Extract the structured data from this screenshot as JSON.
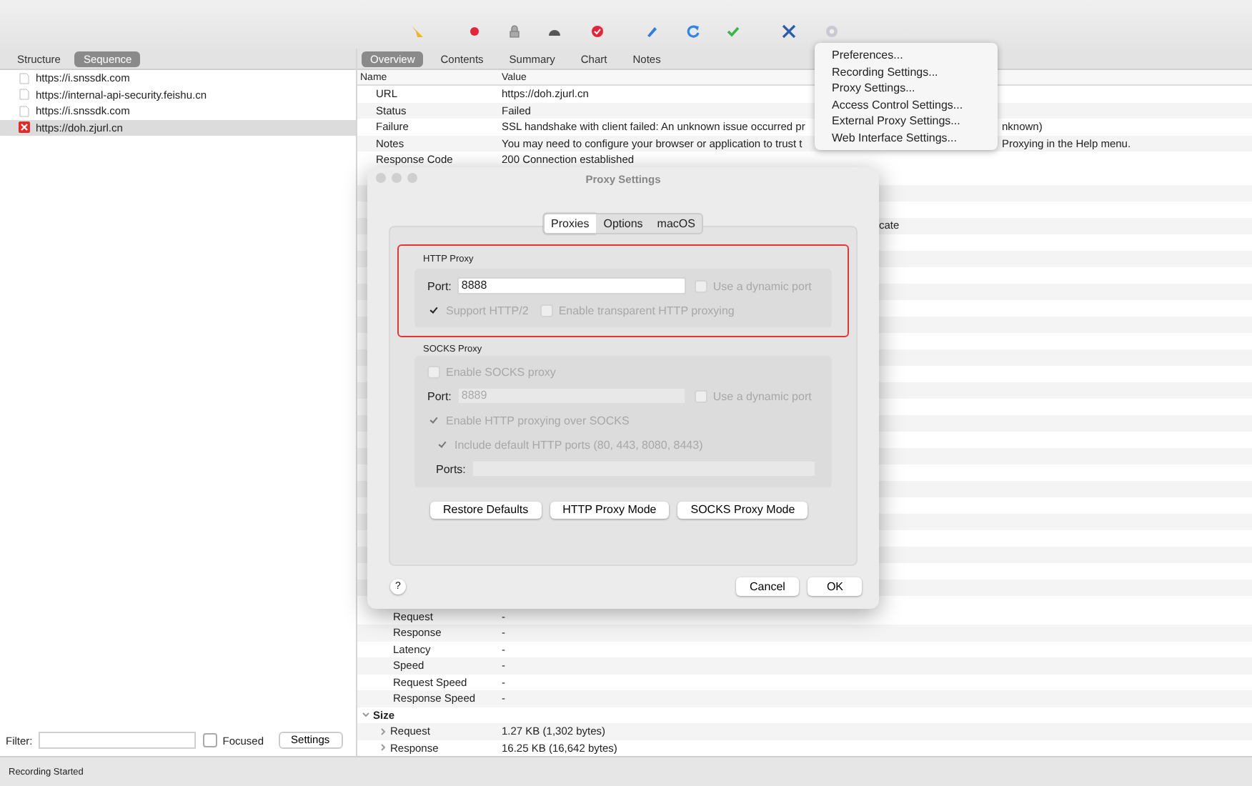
{
  "left_tabs": [
    {
      "label": "Structure",
      "selected": false
    },
    {
      "label": "Sequence",
      "selected": true
    }
  ],
  "hosts": [
    {
      "url": "https://i.snssdk.com",
      "failed": false,
      "selected": false
    },
    {
      "url": "https://internal-api-security.feishu.cn",
      "failed": false,
      "selected": false
    },
    {
      "url": "https://i.snssdk.com",
      "failed": false,
      "selected": false
    },
    {
      "url": "https://doh.zjurl.cn",
      "failed": true,
      "selected": true
    }
  ],
  "filter": {
    "label": "Filter:",
    "focused": {
      "label": "Focused",
      "checked": false
    },
    "settings_button": "Settings"
  },
  "right_tabs": [
    {
      "label": "Overview",
      "selected": true
    },
    {
      "label": "Contents",
      "selected": false
    },
    {
      "label": "Summary",
      "selected": false
    },
    {
      "label": "Chart",
      "selected": false
    },
    {
      "label": "Notes",
      "selected": false
    }
  ],
  "overview": {
    "columns": [
      "Name",
      "Value"
    ],
    "rows_top": [
      {
        "name": "URL",
        "value": "https://doh.zjurl.cn"
      },
      {
        "name": "Status",
        "value": "Failed"
      },
      {
        "name": "Failure",
        "value": "SSL handshake with client failed: An unknown issue occurred pr",
        "value_tail": "nknown)"
      },
      {
        "name": "Notes",
        "value": "You may need to configure your browser or application to trust t",
        "value_tail": "Proxying in the Help menu."
      },
      {
        "name": "Response Code",
        "value": "200 Connection established"
      }
    ],
    "partial_value": "cate",
    "rows_bottom": [
      {
        "kind": "field",
        "name": "Request",
        "value": "-"
      },
      {
        "kind": "field",
        "name": "Response",
        "value": "-"
      },
      {
        "kind": "field",
        "name": "Latency",
        "value": "-"
      },
      {
        "kind": "field",
        "name": "Speed",
        "value": "-"
      },
      {
        "kind": "field",
        "name": "Request Speed",
        "value": "-"
      },
      {
        "kind": "field",
        "name": "Response Speed",
        "value": "-"
      },
      {
        "kind": "group",
        "name": "Size",
        "expanded": true
      },
      {
        "kind": "expandable",
        "name": "Request",
        "value": "1.27 KB (1,302 bytes)",
        "expanded": false
      },
      {
        "kind": "expandable",
        "name": "Response",
        "value": "16.25 KB (16,642 bytes)",
        "expanded": false
      }
    ]
  },
  "menu": {
    "items": [
      "Preferences...",
      "Recording Settings...",
      "Proxy Settings...",
      "Access Control Settings...",
      "External Proxy Settings...",
      "Web Interface Settings..."
    ]
  },
  "dialog": {
    "title": "Proxy Settings",
    "tabs": [
      {
        "label": "Proxies",
        "selected": true
      },
      {
        "label": "Options",
        "selected": false
      },
      {
        "label": "macOS",
        "selected": false
      }
    ],
    "http_proxy": {
      "title": "HTTP Proxy",
      "port_label": "Port:",
      "port": "8888",
      "dynamic_port": {
        "label": "Use a dynamic port",
        "checked": false,
        "disabled": true
      },
      "http2": {
        "label": "Support HTTP/2",
        "checked": true,
        "disabled": true
      },
      "transparent": {
        "label": "Enable transparent HTTP proxying",
        "checked": false,
        "disabled": true
      }
    },
    "socks_proxy": {
      "title": "SOCKS Proxy",
      "enable": {
        "label": "Enable SOCKS proxy",
        "checked": false,
        "disabled": true
      },
      "port_label": "Port:",
      "port": "8889",
      "port_disabled": true,
      "dynamic_port": {
        "label": "Use a dynamic port",
        "checked": false,
        "disabled": true
      },
      "over_socks": {
        "label": "Enable HTTP proxying over SOCKS",
        "checked": true,
        "disabled": true
      },
      "include_default": {
        "label": "Include default HTTP ports (80, 443, 8080, 8443)",
        "checked": true,
        "disabled": true
      },
      "ports_label": "Ports:"
    },
    "mode_buttons": [
      "Restore Defaults",
      "HTTP Proxy Mode",
      "SOCKS Proxy Mode"
    ],
    "help": "?",
    "cancel": "Cancel",
    "ok": "OK"
  },
  "status_bar": "Recording Started"
}
